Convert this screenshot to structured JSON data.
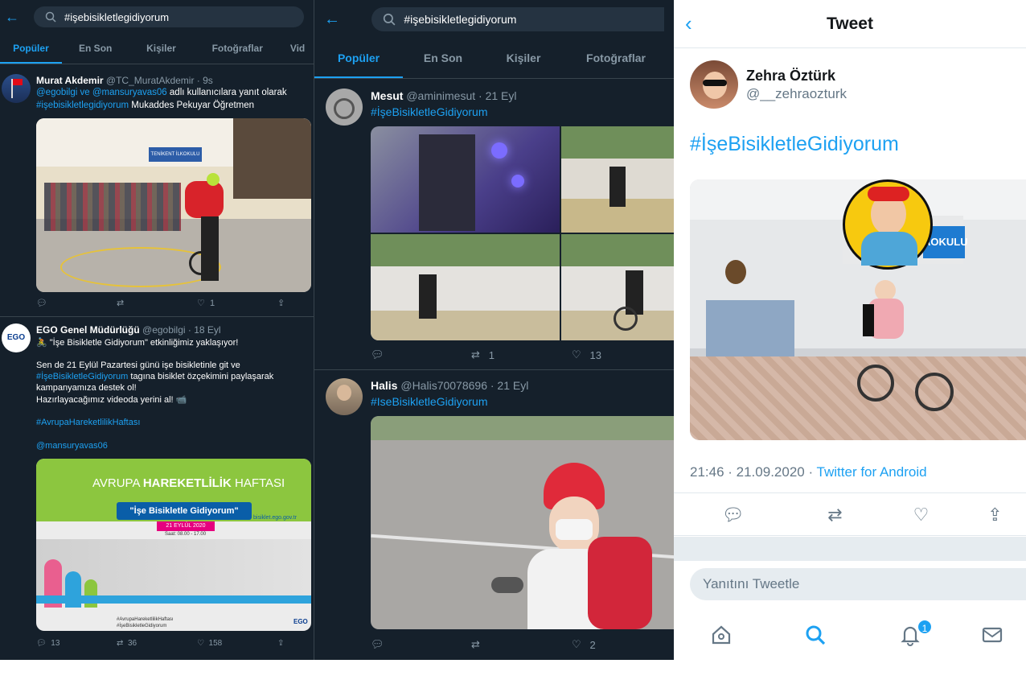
{
  "search": {
    "query": "#işebisikletlegidiyorum"
  },
  "tabs1": [
    "Popüler",
    "En Son",
    "Kişiler",
    "Fotoğraflar",
    "Vid"
  ],
  "tabs2": [
    "Popüler",
    "En Son",
    "Kişiler",
    "Fotoğraflar"
  ],
  "pane1": {
    "tweets": [
      {
        "name": "Murat Akdemir",
        "handle": "@TC_MuratAkdemir · 9s",
        "reply_to": "@egobilgi ve @mansuryavas06",
        "reply_suffix": " adlı kullanıcılara yanıt olarak",
        "hashtag": "#işebisikletlegidiyorum",
        "text": " Mukaddes Pekuyar Öğretmen",
        "sign_school": "TENİKENT İLKOKULU",
        "likes": "1"
      },
      {
        "name": "EGO Genel Müdürlüğü",
        "handle": "@egobilgi · 18 Eyl",
        "line1": "🚴 \"İşe Bisikletle Gidiyorum\" etkinliğimiz yaklaşıyor!",
        "line2": "Sen de 21 Eylül Pazartesi günü işe bisikletinle git ve",
        "line3_tag": "#İşeBisikletleGidiyorum",
        "line3_rest": " tagına bisiklet özçekimini paylaşarak",
        "line4": "kampanyamıza destek ol!",
        "line5": "Hazırlayacağımız videoda yerini al! 📹",
        "tag2": "#AvrupaHareketlilikHaftası",
        "mention": "@mansuryavas06",
        "poster_title_a": "AVRUPA ",
        "poster_title_b": "HAREKETLİLİK",
        "poster_title_c": " HAFTASI",
        "poster_slogan": "\"İşe Bisikletle Gidiyorum\"",
        "poster_date": "21 EYLÜL 2020",
        "poster_time": "Saat: 08.00 - 17.00",
        "poster_url": "bisiklet.ego.gov.tr",
        "poster_tag1": "#AvrupaHareketlilikHaftası",
        "poster_tag2": "#İşeBisikletleGidiyorum",
        "poster_logo": "EGO",
        "logo_text": "EGO",
        "replies": "13",
        "retweets": "36",
        "likes": "158"
      }
    ]
  },
  "pane2": {
    "tweets": [
      {
        "name": "Mesut",
        "handle": "@aminimesut · 21 Eyl",
        "hashtag": "#İşeBisikletleGidiyorum",
        "retweets": "1",
        "likes": "13"
      },
      {
        "name": "Halis",
        "handle": "@Halis70078696 · 21 Eyl",
        "hashtag": "#IseBisikletleGidiyorum",
        "likes": "2"
      }
    ]
  },
  "detail": {
    "title": "Tweet",
    "name": "Zehra Öztürk",
    "handle": "@__zehraozturk",
    "hashtag": "#İşeBisikletleGidiyorum",
    "sign_school": "AOKULU",
    "time": "21:46 · 21.09.2020 · ",
    "source": "Twitter for Android",
    "reply_placeholder": "Yanıtını Tweetle",
    "notif_count": "1"
  },
  "colors": {
    "accent": "#1da1f2",
    "dark_bg": "#15202b",
    "light_text": "#14171a"
  },
  "icons": [
    "back-arrow-icon",
    "search-icon",
    "reply-icon",
    "retweet-icon",
    "like-icon",
    "share-icon",
    "home-icon",
    "notifications-icon",
    "messages-icon"
  ]
}
